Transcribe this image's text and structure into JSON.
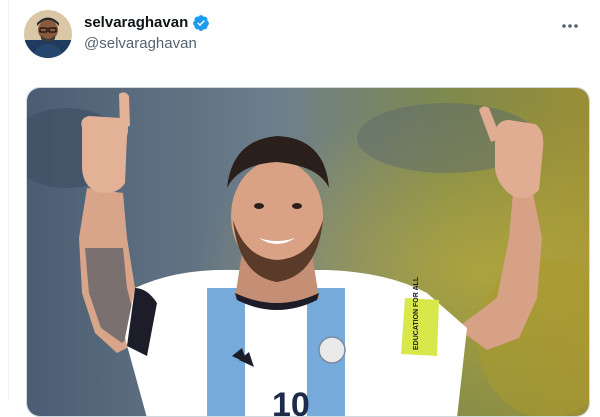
{
  "tweet": {
    "author": {
      "display_name": "selvaraghavan",
      "handle": "@selvaraghavan",
      "verified": true,
      "avatar_icon": "profile-photo"
    },
    "more_icon": "more-horizontal-icon",
    "media": {
      "type": "photo",
      "jersey_number": "10",
      "armband_text": "EDUCATION FOR ALL"
    }
  },
  "colors": {
    "verified_blue": "#1d9bf0",
    "text_primary": "#0f1419",
    "text_secondary": "#536471",
    "jersey_sky_blue": "#75aadb",
    "armband_yellow": "#d8e84a"
  }
}
